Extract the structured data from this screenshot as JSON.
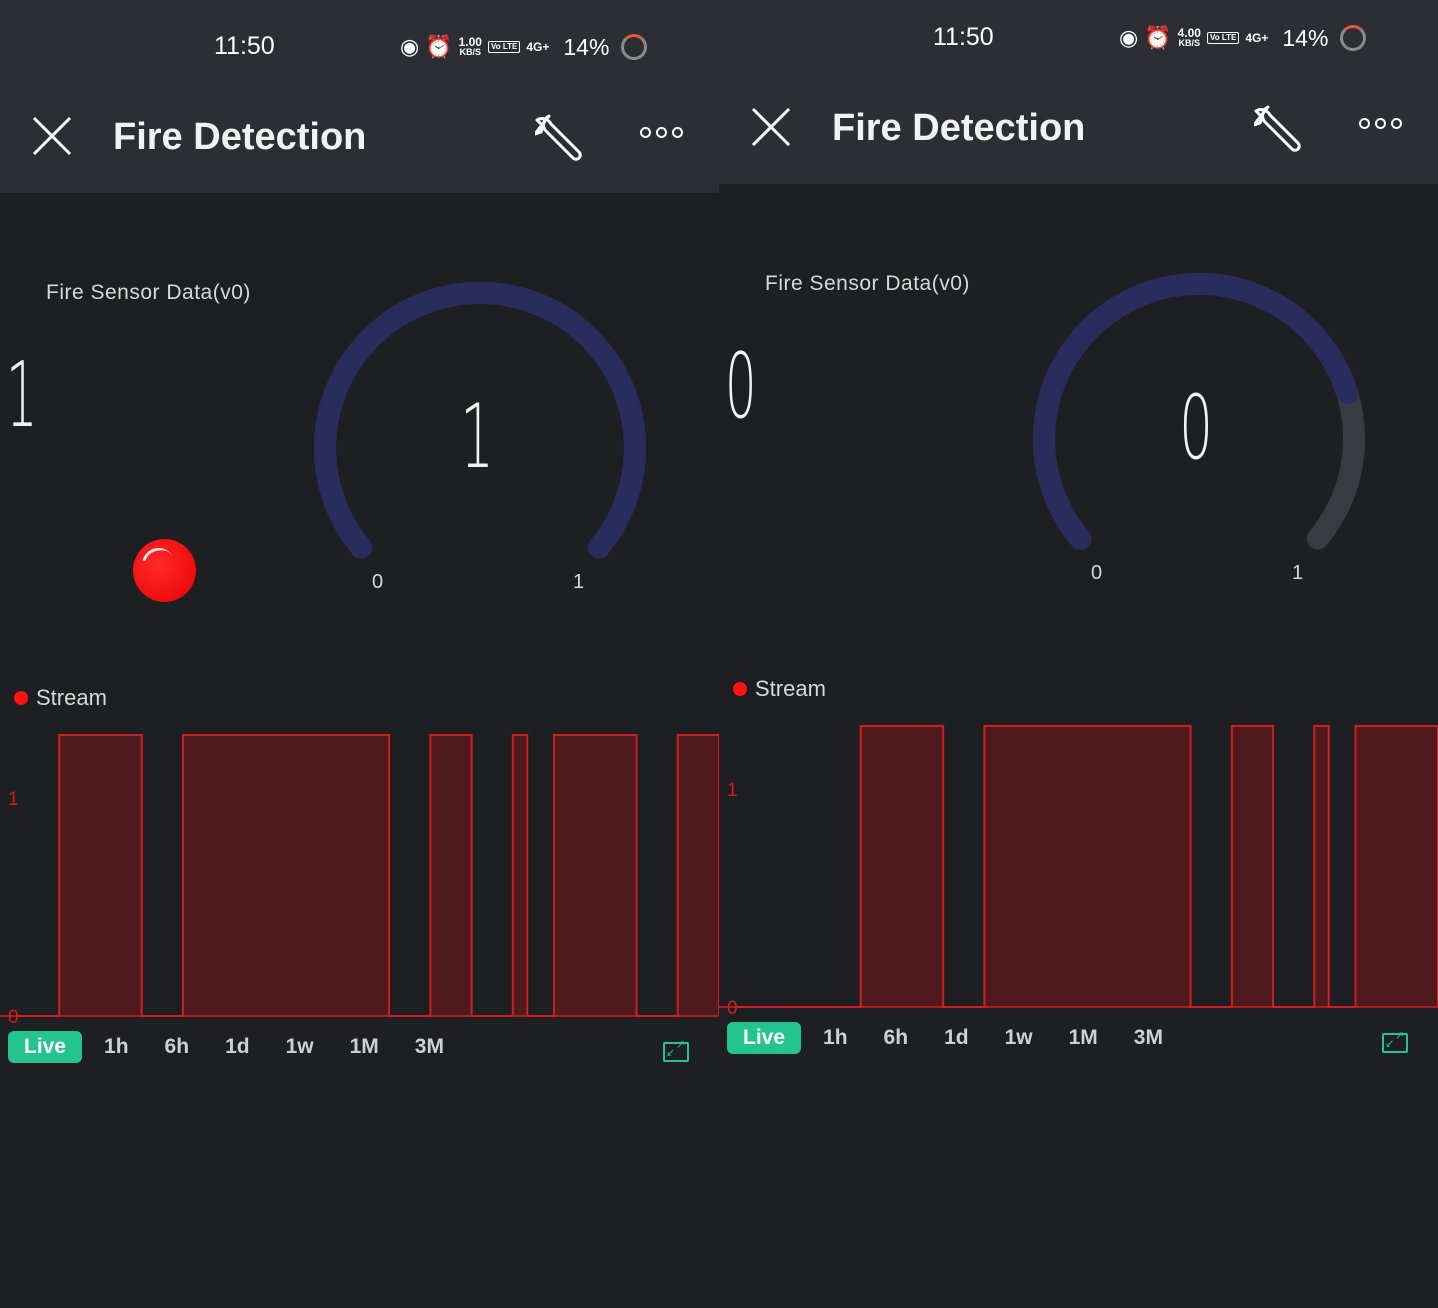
{
  "panels": [
    {
      "status": {
        "time": "11:50",
        "net_speed": "1.00",
        "net_unit": "KB/S",
        "volte": "Vo LTE",
        "signal": "4G+",
        "battery": "14%"
      },
      "app": {
        "title": "Fire Detection"
      },
      "sensor": {
        "label": "Fire Sensor Data(v0)",
        "value": "1",
        "gauge_value": "1",
        "gauge_min": "0",
        "gauge_max": "1",
        "gauge_fraction": 1.0,
        "led_on": true
      },
      "stream": {
        "label": "Stream",
        "ytick_top": "1",
        "ytick_bottom": "0"
      },
      "tabs": [
        "Live",
        "1h",
        "6h",
        "1d",
        "1w",
        "1M",
        "3M"
      ]
    },
    {
      "status": {
        "time": "11:50",
        "net_speed": "4.00",
        "net_unit": "KB/S",
        "volte": "Vo LTE",
        "signal": "4G+",
        "battery": "14%"
      },
      "app": {
        "title": "Fire Detection"
      },
      "sensor": {
        "label": "Fire Sensor Data(v0)",
        "value": "0",
        "gauge_value": "0",
        "gauge_min": "0",
        "gauge_max": "1",
        "gauge_fraction": 0.0,
        "led_on": false
      },
      "stream": {
        "label": "Stream",
        "ytick_top": "1",
        "ytick_bottom": "0"
      },
      "tabs": [
        "Live",
        "1h",
        "6h",
        "1d",
        "1w",
        "1M",
        "3M"
      ]
    }
  ],
  "colors": {
    "accent": "#23c48e",
    "stream_line": "#d21e1e",
    "stream_fill": "#4e1a1d",
    "gauge_arc": "#2b2c5e",
    "gauge_track": "#3a3b40",
    "led": "#ff1414"
  },
  "chart_data": [
    {
      "type": "area",
      "title": "Stream",
      "ylim": [
        0,
        1
      ],
      "segments_on": [
        [
          1,
          3
        ],
        [
          4,
          9
        ],
        [
          10,
          11
        ],
        [
          12,
          12
        ],
        [
          13,
          15
        ],
        [
          16,
          17
        ]
      ],
      "x_range": [
        0,
        17
      ]
    },
    {
      "type": "area",
      "title": "Stream",
      "ylim": [
        0,
        1
      ],
      "segments_on": [
        [
          3,
          5
        ],
        [
          6,
          11
        ],
        [
          12,
          13
        ],
        [
          14,
          14
        ],
        [
          15,
          17
        ]
      ],
      "x_range": [
        0,
        17
      ]
    }
  ]
}
